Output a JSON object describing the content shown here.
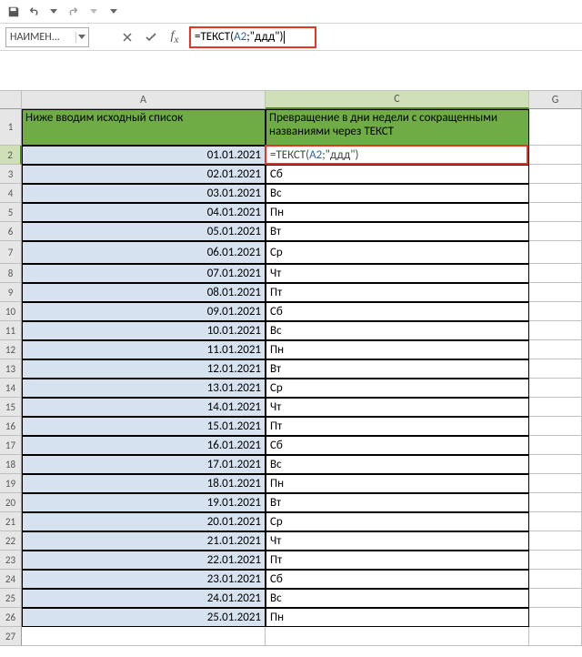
{
  "qat": {},
  "namebox": {
    "value": "НАИМЕН..."
  },
  "formula": {
    "prefix": "=ТЕКСТ(",
    "ref": "A2",
    "suffix": ";\"ддд\")"
  },
  "columns": {
    "A": "A",
    "C": "C",
    "G": "G"
  },
  "header_row": {
    "A": "Ниже вводим исходный список",
    "C": "Превращение в дни недели с сокращенными названиями через ТЕКСТ"
  },
  "editing": {
    "cell": "C2",
    "prefix": "=ТЕКСТ(",
    "ref": "A2",
    "suffix": ";\"ддд\")"
  },
  "rows": [
    {
      "n": 2,
      "a": "01.01.2021",
      "c": ""
    },
    {
      "n": 3,
      "a": "02.01.2021",
      "c": "Сб"
    },
    {
      "n": 4,
      "a": "03.01.2021",
      "c": "Вс"
    },
    {
      "n": 5,
      "a": "04.01.2021",
      "c": "Пн"
    },
    {
      "n": 6,
      "a": "05.01.2021",
      "c": "Вт"
    },
    {
      "n": 7,
      "a": "06.01.2021",
      "c": "Ср"
    },
    {
      "n": 8,
      "a": "07.01.2021",
      "c": "Чт"
    },
    {
      "n": 9,
      "a": "08.01.2021",
      "c": "Пт"
    },
    {
      "n": 10,
      "a": "09.01.2021",
      "c": "Сб"
    },
    {
      "n": 11,
      "a": "10.01.2021",
      "c": "Вс"
    },
    {
      "n": 12,
      "a": "11.01.2021",
      "c": "Пн"
    },
    {
      "n": 13,
      "a": "12.01.2021",
      "c": "Вт"
    },
    {
      "n": 14,
      "a": "13.01.2021",
      "c": "Ср"
    },
    {
      "n": 15,
      "a": "14.01.2021",
      "c": "Чт"
    },
    {
      "n": 16,
      "a": "15.01.2021",
      "c": "Пт"
    },
    {
      "n": 17,
      "a": "16.01.2021",
      "c": "Сб"
    },
    {
      "n": 18,
      "a": "17.01.2021",
      "c": "Вс"
    },
    {
      "n": 19,
      "a": "18.01.2021",
      "c": "Пн"
    },
    {
      "n": 20,
      "a": "19.01.2021",
      "c": "Вт"
    },
    {
      "n": 21,
      "a": "20.01.2021",
      "c": "Ср"
    },
    {
      "n": 22,
      "a": "21.01.2021",
      "c": "Чт"
    },
    {
      "n": 23,
      "a": "22.01.2021",
      "c": "Пт"
    },
    {
      "n": 24,
      "a": "23.01.2021",
      "c": "Сб"
    },
    {
      "n": 25,
      "a": "24.01.2021",
      "c": "Вс"
    },
    {
      "n": 26,
      "a": "25.01.2021",
      "c": "Пн"
    },
    {
      "n": 27,
      "a": "",
      "c": ""
    }
  ]
}
